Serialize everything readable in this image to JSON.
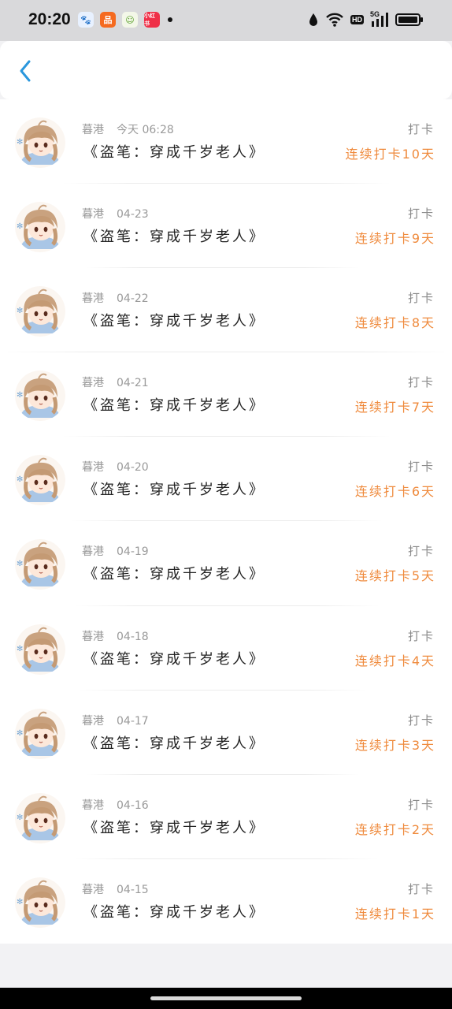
{
  "status_bar": {
    "time": "20:20",
    "app_icons": [
      {
        "name": "baidu-app-icon",
        "glyph": "🐾"
      },
      {
        "name": "taobao-app-icon",
        "glyph": "品"
      },
      {
        "name": "leaf-app-icon",
        "glyph": "☺"
      },
      {
        "name": "xiaohongshu-app-icon",
        "glyph": "小红书"
      }
    ],
    "hd_label": "HD",
    "network_label": "5G"
  },
  "header": {
    "back_icon": "chevron-left-icon",
    "accent_color": "#2a97dd"
  },
  "list": {
    "items": [
      {
        "user": "暮港",
        "date": "今天 06:28",
        "book": "《盗笔：穿成千岁老人》",
        "action": "打卡",
        "streak": "连续打卡10天"
      },
      {
        "user": "暮港",
        "date": "04-23",
        "book": "《盗笔：穿成千岁老人》",
        "action": "打卡",
        "streak": "连续打卡9天"
      },
      {
        "user": "暮港",
        "date": "04-22",
        "book": "《盗笔：穿成千岁老人》",
        "action": "打卡",
        "streak": "连续打卡8天"
      },
      {
        "user": "暮港",
        "date": "04-21",
        "book": "《盗笔：穿成千岁老人》",
        "action": "打卡",
        "streak": "连续打卡7天"
      },
      {
        "user": "暮港",
        "date": "04-20",
        "book": "《盗笔：穿成千岁老人》",
        "action": "打卡",
        "streak": "连续打卡6天"
      },
      {
        "user": "暮港",
        "date": "04-19",
        "book": "《盗笔：穿成千岁老人》",
        "action": "打卡",
        "streak": "连续打卡5天"
      },
      {
        "user": "暮港",
        "date": "04-18",
        "book": "《盗笔：穿成千岁老人》",
        "action": "打卡",
        "streak": "连续打卡4天"
      },
      {
        "user": "暮港",
        "date": "04-17",
        "book": "《盗笔：穿成千岁老人》",
        "action": "打卡",
        "streak": "连续打卡3天"
      },
      {
        "user": "暮港",
        "date": "04-16",
        "book": "《盗笔：穿成千岁老人》",
        "action": "打卡",
        "streak": "连续打卡2天"
      },
      {
        "user": "暮港",
        "date": "04-15",
        "book": "《盗笔：穿成千岁老人》",
        "action": "打卡",
        "streak": "连续打卡1天"
      }
    ],
    "streak_color": "#ef8a3c"
  }
}
